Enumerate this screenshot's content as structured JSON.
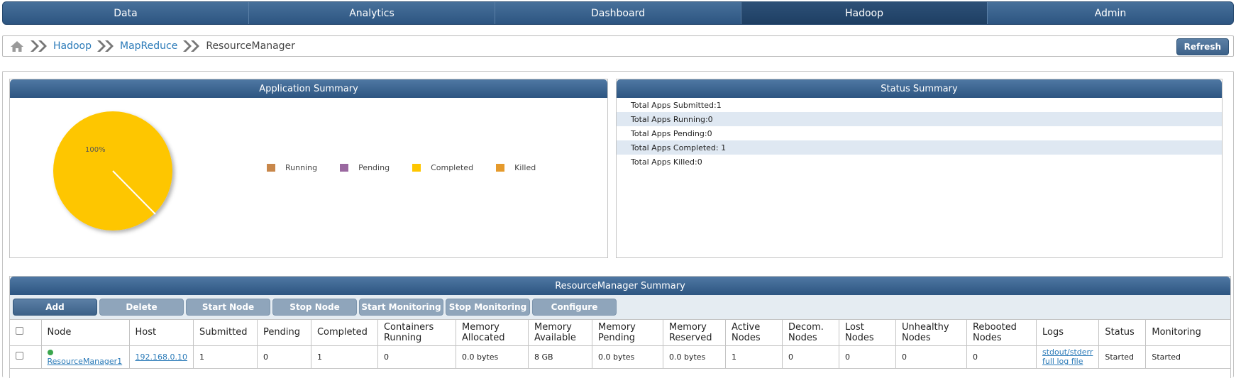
{
  "nav": {
    "tabs": [
      {
        "label": "Data"
      },
      {
        "label": "Analytics"
      },
      {
        "label": "Dashboard"
      },
      {
        "label": "Hadoop"
      },
      {
        "label": "Admin"
      }
    ],
    "active": "Hadoop"
  },
  "breadcrumb": {
    "items": [
      "Hadoop",
      "MapReduce"
    ],
    "current": "ResourceManager",
    "refresh_label": "Refresh"
  },
  "app_summary": {
    "title": "Application Summary",
    "pie_label": "100%",
    "legend": [
      {
        "label": "Running",
        "color": "#c8874a"
      },
      {
        "label": "Pending",
        "color": "#9a68a0"
      },
      {
        "label": "Completed",
        "color": "#fec600"
      },
      {
        "label": "Killed",
        "color": "#e59a2c"
      }
    ]
  },
  "status_summary": {
    "title": "Status Summary",
    "rows": [
      "Total Apps Submitted:1",
      "Total Apps Running:0",
      "Total Apps Pending:0",
      "Total Apps Completed: 1",
      "Total Apps Killed:0"
    ]
  },
  "rm_summary": {
    "title": "ResourceManager Summary",
    "buttons": [
      "Add",
      "Delete",
      "Start Node",
      "Stop Node",
      "Start Monitoring",
      "Stop Monitoring",
      "Configure"
    ],
    "columns": [
      "Node",
      "Host",
      "Submitted",
      "Pending",
      "Completed",
      "Containers Running",
      "Memory Allocated",
      "Memory Available",
      "Memory Pending",
      "Memory Reserved",
      "Active Nodes",
      "Decom. Nodes",
      "Lost Nodes",
      "Unhealthy Nodes",
      "Rebooted Nodes",
      "Logs",
      "Status",
      "Monitoring"
    ],
    "rows": [
      {
        "node": "ResourceManager1",
        "host": "192.168.0.10",
        "submitted": "1",
        "pending": "0",
        "completed": "1",
        "containers_running": "0",
        "memory_allocated": "0.0 bytes",
        "memory_available": "8 GB",
        "memory_pending": "0.0 bytes",
        "memory_reserved": "0.0 bytes",
        "active_nodes": "1",
        "decom_nodes": "0",
        "lost_nodes": "0",
        "unhealthy_nodes": "0",
        "rebooted_nodes": "0",
        "logs": [
          "stdout/stderr",
          "full log file"
        ],
        "status": "Started",
        "monitoring": "Started"
      }
    ]
  }
}
